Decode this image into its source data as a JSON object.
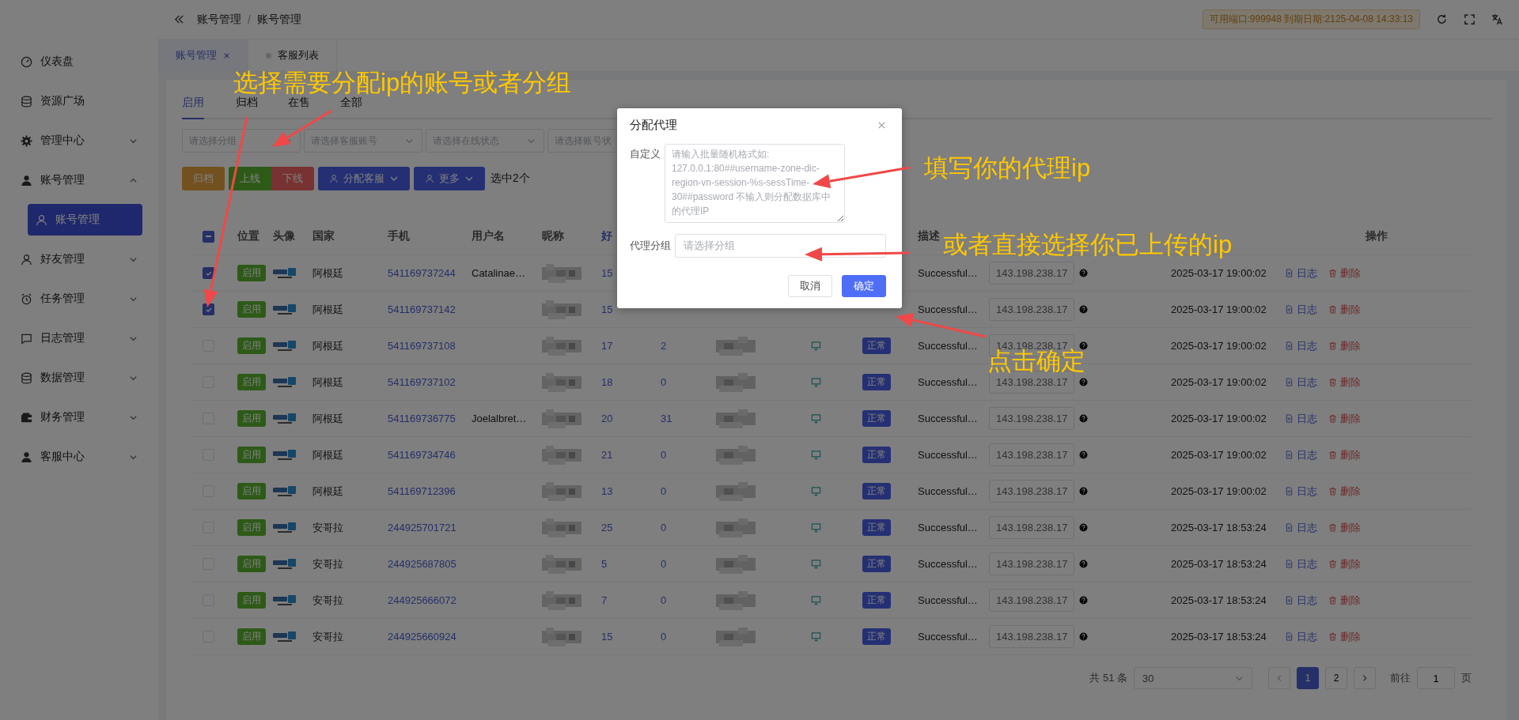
{
  "topbar": {
    "breadcrumb": [
      "账号管理",
      "账号管理"
    ],
    "separator": "/",
    "badge": "可用端口:999948 到期日期:2125-04-08 14:33:13"
  },
  "page_tabs": [
    {
      "label": "账号管理",
      "selected": true
    },
    {
      "label": "客服列表",
      "selected": false
    }
  ],
  "sidebar": {
    "items": [
      {
        "label": "仪表盘"
      },
      {
        "label": "资源广场"
      },
      {
        "label": "管理中心",
        "expanded": false
      },
      {
        "label": "账号管理",
        "expanded": true,
        "children": [
          {
            "label": "账号管理",
            "selected": true
          }
        ]
      },
      {
        "label": "好友管理",
        "expanded": false
      },
      {
        "label": "任务管理",
        "expanded": false
      },
      {
        "label": "日志管理",
        "expanded": false
      },
      {
        "label": "数据管理",
        "expanded": false
      },
      {
        "label": "财务管理",
        "expanded": false
      },
      {
        "label": "客服中心",
        "expanded": false
      }
    ]
  },
  "status_tabs": [
    {
      "label": "启用",
      "selected": true
    },
    {
      "label": "归档",
      "selected": false
    },
    {
      "label": "在售",
      "selected": false
    },
    {
      "label": "全部",
      "selected": false
    }
  ],
  "filters": [
    {
      "placeholder": "请选择分组"
    },
    {
      "placeholder": "请选择客服账号"
    },
    {
      "placeholder": "请选择在线状态"
    },
    {
      "placeholder": "请选择账号状"
    }
  ],
  "toolbar": {
    "buttons": [
      {
        "kind": "archive",
        "label": "归档"
      },
      {
        "kind": "online",
        "label": "上线"
      },
      {
        "kind": "offline",
        "label": "下线"
      },
      {
        "kind": "assign",
        "label": "分配客服"
      },
      {
        "kind": "more",
        "label": "更多"
      }
    ],
    "selection": "选中2个"
  },
  "table": {
    "header_indeterminate": true,
    "columns": {
      "position": "位置",
      "avatar": "头像",
      "country": "国家",
      "phone": "手机",
      "username": "用户名",
      "nickname": "昵称",
      "column_8": "好",
      "description": "描述",
      "actions": "操作"
    },
    "rows": [
      {
        "checked": true,
        "tag": "启用",
        "country": "阿根廷",
        "phone": "541169737244",
        "username": "Catalinae…",
        "friends": "15",
        "description": "Successful…",
        "proxy_ip": "143.198.238.17",
        "date": "2025-03-17 19:00:02",
        "actions": [
          "日志",
          "删除"
        ]
      },
      {
        "checked": true,
        "tag": "启用",
        "country": "阿根廷",
        "phone": "541169737142",
        "friends": "15",
        "description": "Successful…",
        "proxy_ip": "143.198.238.17",
        "date": "2025-03-17 19:00:02",
        "actions": [
          "日志",
          "删除"
        ]
      },
      {
        "checked": false,
        "tag": "启用",
        "country": "阿根廷",
        "phone": "541169737108",
        "friends": "17",
        "column_9": "2",
        "status": "正常",
        "description": "Successful…",
        "proxy_ip": "143.198.238.17",
        "date": "2025-03-17 19:00:02",
        "actions": [
          "日志",
          "删除"
        ]
      },
      {
        "checked": false,
        "tag": "启用",
        "country": "阿根廷",
        "phone": "541169737102",
        "friends": "18",
        "column_9": "0",
        "status": "正常",
        "description": "Successful…",
        "proxy_ip": "143.198.238.17",
        "date": "2025-03-17 19:00:02",
        "actions": [
          "日志",
          "删除"
        ]
      },
      {
        "checked": false,
        "tag": "启用",
        "country": "阿根廷",
        "phone": "541169736775",
        "username": "Joelalbret…",
        "friends": "20",
        "column_9": "31",
        "status": "正常",
        "description": "Successful…",
        "proxy_ip": "143.198.238.17",
        "date": "2025-03-17 19:00:02",
        "actions": [
          "日志",
          "删除"
        ]
      },
      {
        "checked": false,
        "tag": "启用",
        "country": "阿根廷",
        "phone": "541169734746",
        "friends": "21",
        "column_9": "0",
        "status": "正常",
        "description": "Successful…",
        "proxy_ip": "143.198.238.17",
        "date": "2025-03-17 19:00:02",
        "actions": [
          "日志",
          "删除"
        ]
      },
      {
        "checked": false,
        "tag": "启用",
        "country": "阿根廷",
        "phone": "541169712396",
        "friends": "13",
        "column_9": "0",
        "status": "正常",
        "description": "Successful…",
        "proxy_ip": "143.198.238.17",
        "date": "2025-03-17 19:00:02",
        "actions": [
          "日志",
          "删除"
        ]
      },
      {
        "checked": false,
        "tag": "启用",
        "country": "安哥拉",
        "phone": "244925701721",
        "friends": "25",
        "column_9": "0",
        "status": "正常",
        "description": "Successful…",
        "proxy_ip": "143.198.238.17",
        "date": "2025-03-17 18:53:24",
        "actions": [
          "日志",
          "删除"
        ]
      },
      {
        "checked": false,
        "tag": "启用",
        "country": "安哥拉",
        "phone": "244925687805",
        "friends": "5",
        "column_9": "0",
        "status": "正常",
        "description": "Successful…",
        "proxy_ip": "143.198.238.17",
        "date": "2025-03-17 18:53:24",
        "actions": [
          "日志",
          "删除"
        ]
      },
      {
        "checked": false,
        "tag": "启用",
        "country": "安哥拉",
        "phone": "244925666072",
        "friends": "7",
        "column_9": "0",
        "status": "正常",
        "description": "Successful…",
        "proxy_ip": "143.198.238.17",
        "date": "2025-03-17 18:53:24",
        "actions": [
          "日志",
          "删除"
        ]
      },
      {
        "checked": false,
        "tag": "启用",
        "country": "安哥拉",
        "phone": "244925660924",
        "friends": "15",
        "column_9": "0",
        "status": "正常",
        "description": "Successful…",
        "proxy_ip": "143.198.238.17",
        "date": "2025-03-17 18:53:24",
        "actions": [
          "日志",
          "删除"
        ]
      }
    ]
  },
  "pagination": {
    "total": "共 51 条",
    "page_size": "30",
    "pages": [
      {
        "label": "1",
        "selected": true
      },
      {
        "label": "2",
        "selected": false
      }
    ],
    "goto_label": "前往",
    "goto_value": "1",
    "page_unit": "页"
  },
  "dialog": {
    "title": "分配代理",
    "fields": [
      {
        "kind": "textarea",
        "label": "自定义",
        "placeholder": "请输入批量随机格式如:\n127.0.0.1:80##username-zone-dic-region-vn-session-%s-sessTime-30##password 不输入则分配数据库中的代理IP"
      },
      {
        "kind": "select",
        "label": "代理分组",
        "placeholder": "请选择分组"
      }
    ],
    "buttons": [
      {
        "kind": "cancel",
        "label": "取消"
      },
      {
        "kind": "confirm",
        "label": "确定"
      }
    ]
  },
  "annotations": [
    {
      "text": "选择需要分配ip的账号或者分组"
    },
    {
      "text": "填写你的代理ip"
    },
    {
      "text": "或者直接选择你已上传的ip"
    },
    {
      "text": "点击确定"
    }
  ]
}
